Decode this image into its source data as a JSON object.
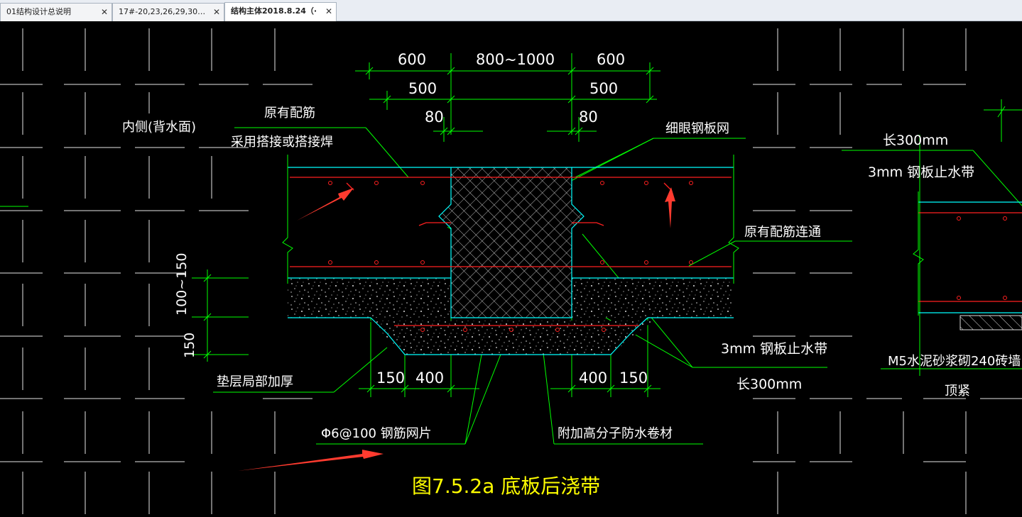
{
  "tabs": [
    {
      "label": "01结构设计总说明",
      "active": false
    },
    {
      "label": "17#-20,23,26,29,30…",
      "active": false
    },
    {
      "label": "结构主体2018.8.24（·",
      "active": true
    }
  ],
  "close_glyph": "✕",
  "colors": {
    "background": "#000000",
    "grid": "#ffffff",
    "dimension": "#00ff00",
    "outline": "#00ffff",
    "rebar": "#ff2020",
    "title": "#ffff00",
    "annotation_arrow": "#ff3b2f"
  },
  "drawing": {
    "dims": {
      "d600_left": "600",
      "d800_1000": "800~1000",
      "d600_right": "600",
      "d500_left": "500",
      "d500_right": "500",
      "d80_left": "80",
      "d80_right": "80",
      "d100_150": "100~150",
      "d150_vert": "150",
      "d150_bl": "150",
      "d400_bl": "400",
      "d400_br": "400",
      "d150_br": "150"
    },
    "labels": {
      "inner_side": "内侧(背水面)",
      "orig_rebar": "原有配筋",
      "lap_weld": "采用搭接或搭接焊",
      "fine_mesh": "细眼钢板网",
      "orig_rebar_cont": "原有配筋连通",
      "steel_waterstop": "3mm 钢板止水带",
      "len300": "长300mm",
      "cushion_thicken": "垫层局部加厚",
      "mesh_phi6": "Φ6@100 钢筋网片",
      "membrane": "附加高分子防水卷材",
      "right_len300": "长300mm",
      "right_waterstop": "3mm 钢板止水带",
      "brick_wall": "M5水泥砂浆砌240砖墙",
      "top_tight": "顶紧"
    },
    "title": "图7.5.2a  底板后浇带"
  }
}
